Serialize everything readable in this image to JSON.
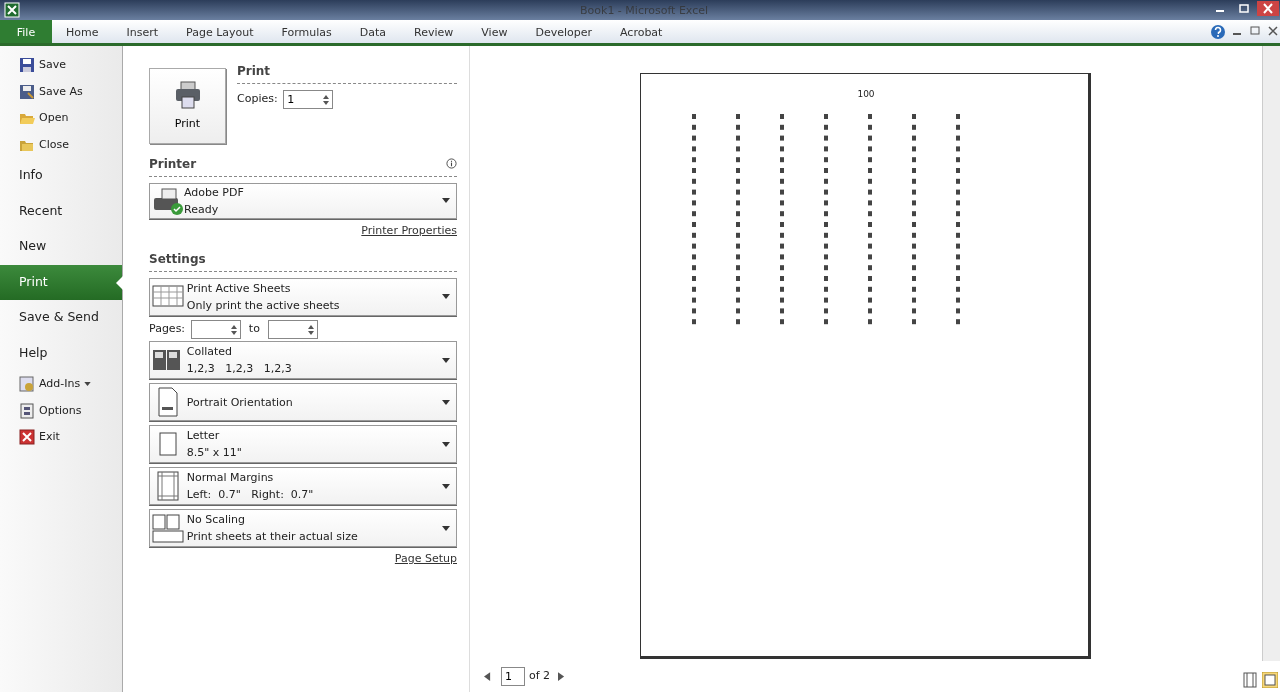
{
  "window": {
    "title": "Book1 - Microsoft Excel"
  },
  "ribbon_tabs": [
    {
      "label": "File",
      "selected": true
    },
    {
      "label": "Home",
      "selected": false
    },
    {
      "label": "Insert",
      "selected": false
    },
    {
      "label": "Page Layout",
      "selected": false
    },
    {
      "label": "Formulas",
      "selected": false
    },
    {
      "label": "Data",
      "selected": false
    },
    {
      "label": "Review",
      "selected": false
    },
    {
      "label": "View",
      "selected": false
    },
    {
      "label": "Developer",
      "selected": false
    },
    {
      "label": "Acrobat",
      "selected": false
    }
  ],
  "nav": [
    {
      "label": "Save",
      "kind": "save",
      "selected": false
    },
    {
      "label": "Save As",
      "kind": "saveas",
      "selected": false
    },
    {
      "label": "Open",
      "kind": "open",
      "selected": false
    },
    {
      "label": "Close",
      "kind": "close",
      "selected": false
    },
    {
      "label": "Info",
      "kind": "section",
      "selected": false
    },
    {
      "label": "Recent",
      "kind": "section",
      "selected": false
    },
    {
      "label": "New",
      "kind": "section",
      "selected": false
    },
    {
      "label": "Print",
      "kind": "section",
      "selected": true
    },
    {
      "label": "Save & Send",
      "kind": "section",
      "selected": false
    },
    {
      "label": "Help",
      "kind": "section",
      "selected": false
    },
    {
      "label": "Add-Ins",
      "kind": "addins",
      "selected": false,
      "dropdown": true
    },
    {
      "label": "Options",
      "kind": "options",
      "selected": false
    },
    {
      "label": "Exit",
      "kind": "exit",
      "selected": false
    }
  ],
  "print": {
    "heading": "Print",
    "button_label": "Print",
    "copies_label": "Copies:",
    "copies": "1"
  },
  "printer": {
    "heading": "Printer",
    "name": "Adobe PDF",
    "status": "Ready",
    "properties_link": "Printer Properties"
  },
  "settings": {
    "heading": "Settings",
    "pages_label": "Pages:",
    "to_label": "to",
    "page_setup_link": "Page Setup",
    "options": [
      {
        "kind": "sheets",
        "title": "Print Active Sheets",
        "subtitle": "Only print the active sheets"
      },
      {
        "kind": "collated",
        "title": "Collated",
        "subtitle": "1,2,3   1,2,3   1,2,3"
      },
      {
        "kind": "portrait",
        "title": "Portrait Orientation"
      },
      {
        "kind": "letter",
        "title": "Letter",
        "subtitle": "8.5\" x 11\""
      },
      {
        "kind": "margins",
        "title": "Normal Margins",
        "subtitle": "Left:  0.7\"   Right:  0.7\""
      },
      {
        "kind": "scaling",
        "title": "No Scaling",
        "subtitle": "Print sheets at their actual size"
      }
    ]
  },
  "preview": {
    "header": "100",
    "page": "1",
    "page_count": "of 2"
  }
}
